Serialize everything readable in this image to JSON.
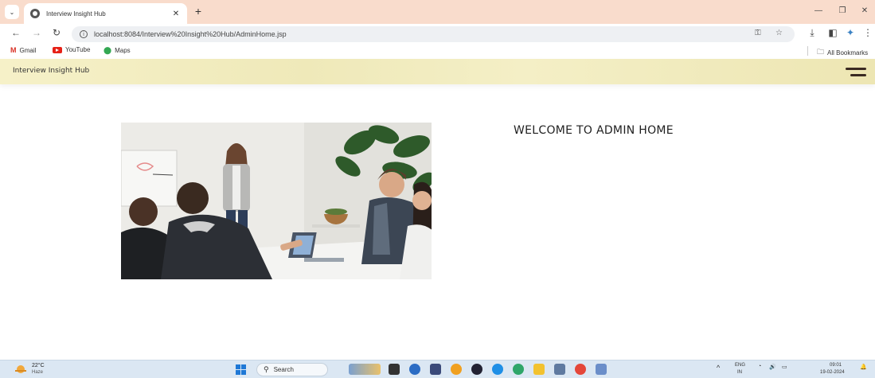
{
  "browser": {
    "tab_title": "Interview Insight Hub",
    "url": "localhost:8084/Interview%20Insight%20Hub/AdminHome.jsp",
    "bookmarks": [
      {
        "label": "Gmail",
        "icon": "gmail-icon"
      },
      {
        "label": "YouTube",
        "icon": "youtube-icon"
      },
      {
        "label": "Maps",
        "icon": "maps-icon"
      }
    ],
    "all_bookmarks_label": "All Bookmarks"
  },
  "page": {
    "brand": "Interview Insight Hub",
    "welcome": "WELCOME TO ADMIN HOME",
    "header_color": "#f3eec4"
  },
  "taskbar": {
    "weather_temp": "22°C",
    "weather_desc": "Haze",
    "search_placeholder": "Search",
    "lang_top": "ENG",
    "lang_bottom": "IN",
    "time": "09:01",
    "date": "19-02-2024",
    "accent": "#1e78d6"
  }
}
